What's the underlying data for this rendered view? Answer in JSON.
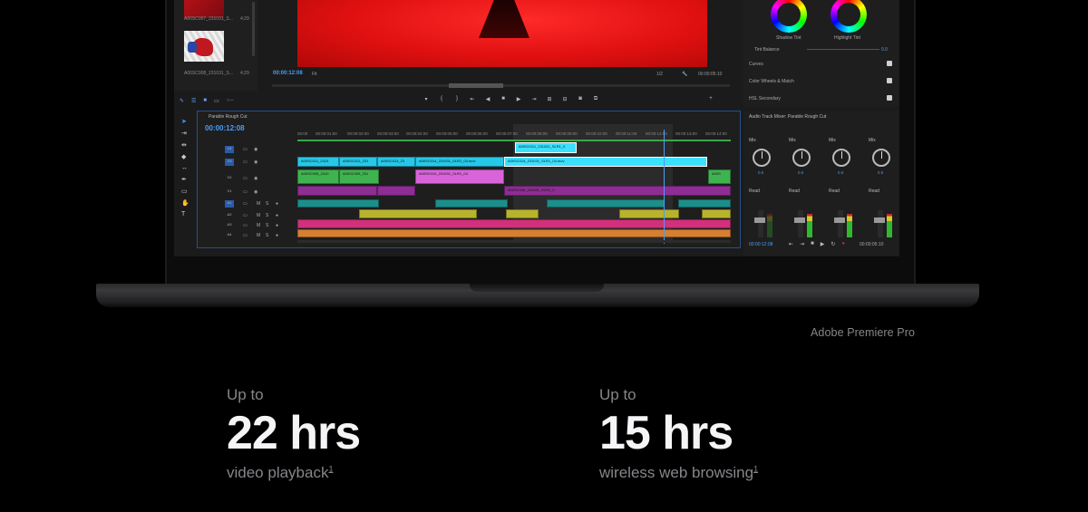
{
  "product_caption": "Adobe Premiere Pro",
  "stats": [
    {
      "prefix": "Up to",
      "value": "22 hrs",
      "label": "video playback",
      "footnote": "1"
    },
    {
      "prefix": "Up to",
      "value": "15 hrs",
      "label": "wireless web browsing",
      "footnote": "1"
    }
  ],
  "premiere": {
    "bin": {
      "clips": [
        {
          "name": "A00SC007_231031_S...",
          "duration": "4;29"
        },
        {
          "name": "A00SC008_231031_S...",
          "duration": "4;29"
        }
      ]
    },
    "monitor": {
      "timecode": "00:00:12:08",
      "fit": "Fit",
      "resolution": "1/2",
      "duration": "00:00:05:10"
    },
    "lumetri": {
      "shadow_tint": "Shadow Tint",
      "highlight_tint": "Highlight Tint",
      "tint_balance": "Tint Balance",
      "tint_value": "0.0",
      "sections": [
        "Curves",
        "Color Wheels & Match",
        "HSL Secondary"
      ]
    },
    "timeline": {
      "title": "Parable Rough Cut",
      "timecode": "00:00:12:08",
      "ruler": [
        "00:00",
        "00:00:01:00",
        "00:00:02:00",
        "00:00:03:00",
        "00:00:04:00",
        "00:00:05:00",
        "00:00:06:00",
        "00:00:07:00",
        "00:00:08:00",
        "00:00:09:00",
        "00:00:10:00",
        "00:00:11:00",
        "00:00:12:00",
        "00:00:13:00",
        "00:00:14:00"
      ],
      "video_tracks": [
        "V4",
        "V3",
        "V2",
        "V1"
      ],
      "audio_tracks": [
        "A1",
        "A2",
        "A3",
        "A4"
      ],
      "clips": {
        "v4a": "A00SC011_231031_SLR1_0",
        "v3a": "A00SC011_2310",
        "v3b": "A00SC012_231",
        "v3c": "A00SC013_23",
        "v3d": "A00SC014_231031_SLR1_04.mov",
        "v3e": "A00SC015_231031_SLR1_04.mov",
        "v2a": "A00SC008_2310",
        "v2b": "A00SC009_231",
        "v2c": "A00SC010_231031_SLR1_04",
        "v2d": "A00S",
        "v1a": "A00SC006_231031_SLR1_0"
      }
    },
    "mixer": {
      "title": "Audio Track Mixer: Parable Rough Cut",
      "channels": [
        {
          "mix": "Mix",
          "value": "0.0",
          "mode": "Read"
        },
        {
          "mix": "Mix",
          "value": "0.0",
          "mode": "Read"
        },
        {
          "mix": "Mix",
          "value": "0.0",
          "mode": "Read"
        },
        {
          "mix": "Mix",
          "value": "0.0",
          "mode": "Read"
        }
      ],
      "timecode": "00:00:12:08",
      "duration": "00:00:05:10"
    }
  },
  "colors": {
    "accent_blue": "#4a9df8",
    "caption_gray": "#86868b",
    "headline_white": "#f5f5f7"
  }
}
